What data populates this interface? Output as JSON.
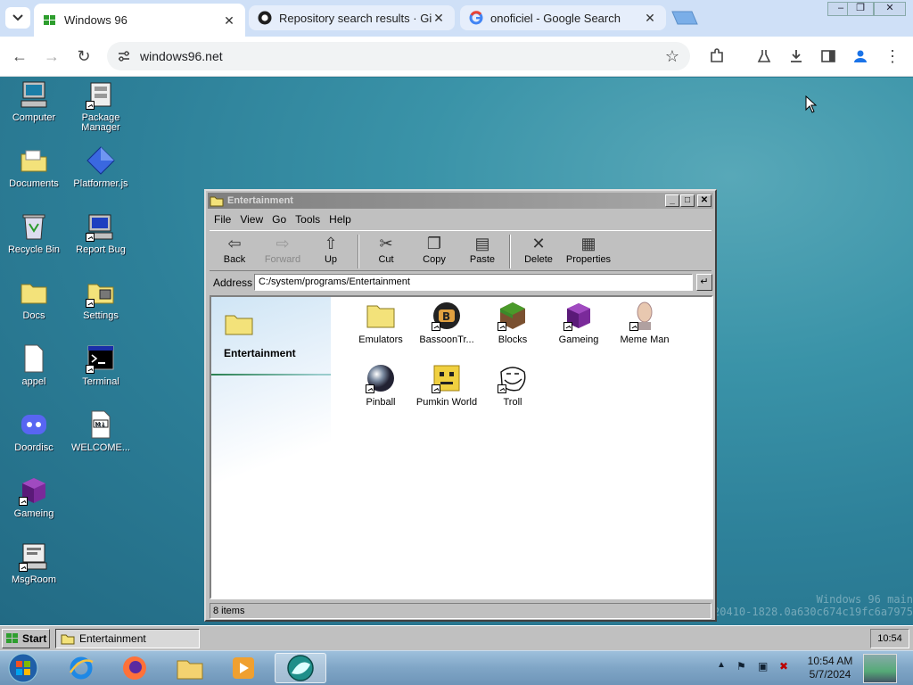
{
  "browser": {
    "tabs": [
      {
        "title": "Windows 96",
        "active": true
      },
      {
        "title": "Repository search results · GitHub",
        "active": false
      },
      {
        "title": "onoficiel - Google Search",
        "active": false
      }
    ],
    "url": "windows96.net"
  },
  "desktop": {
    "icons": [
      {
        "label": "Computer"
      },
      {
        "label": "Package Manager"
      },
      {
        "label": "Documents"
      },
      {
        "label": "Platformer.js"
      },
      {
        "label": "Recycle Bin"
      },
      {
        "label": "Report Bug"
      },
      {
        "label": "Docs"
      },
      {
        "label": "Settings"
      },
      {
        "label": "appel"
      },
      {
        "label": "Terminal"
      },
      {
        "label": "Doordisc"
      },
      {
        "label": "WELCOME..."
      },
      {
        "label": "Gameing"
      },
      {
        "label": "MsgRoom"
      }
    ],
    "watermark": [
      "Windows 96 main",
      "20410-1828.0a630c674c19fc6a7975"
    ]
  },
  "explorer": {
    "title": "Entertainment",
    "menu": [
      "File",
      "View",
      "Go",
      "Tools",
      "Help"
    ],
    "toolbar": [
      "Back",
      "Forward",
      "Up",
      "Cut",
      "Copy",
      "Paste",
      "Delete",
      "Properties"
    ],
    "address_label": "Address",
    "address": "C:/system/programs/Entertainment",
    "folder_name": "Entertainment",
    "items": [
      {
        "label": "Emulators"
      },
      {
        "label": "BassoonTr..."
      },
      {
        "label": "Blocks"
      },
      {
        "label": "Gameing"
      },
      {
        "label": "Meme Man"
      },
      {
        "label": "Pinball"
      },
      {
        "label": "Pumkin World"
      },
      {
        "label": "Troll"
      }
    ],
    "status": "8 items"
  },
  "w96taskbar": {
    "start": "Start",
    "task": "Entertainment",
    "clock": "10:54"
  },
  "w7taskbar": {
    "time": "10:54 AM",
    "date": "5/7/2024"
  }
}
